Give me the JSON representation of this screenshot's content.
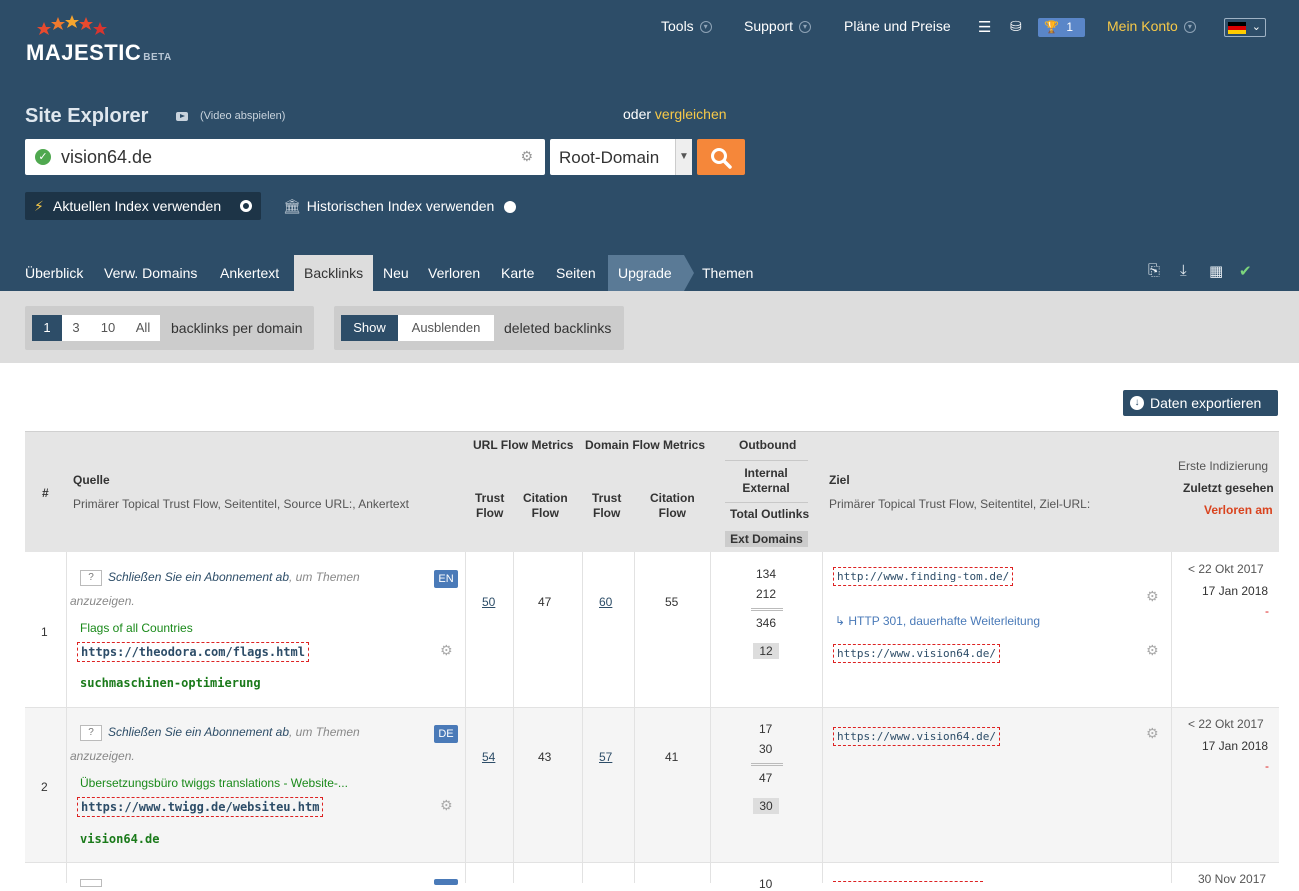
{
  "app": {
    "logo": "MAJESTIC",
    "beta": "BETA"
  },
  "topnav": {
    "tools": "Tools",
    "support": "Support",
    "plans": "Pläne und Preise",
    "trophy_count": "1",
    "account": "Mein Konto"
  },
  "search": {
    "title": "Site Explorer",
    "video": "(Video abspielen)",
    "oder": "oder",
    "compare": "vergleichen",
    "value": "vision64.de",
    "scope": "Root-Domain"
  },
  "index": {
    "current": "Aktuellen Index verwenden",
    "historic": "Historischen Index verwenden"
  },
  "tabs": [
    "Überblick",
    "Verw. Domains",
    "Ankertext",
    "Backlinks",
    "Neu",
    "Verloren",
    "Karte",
    "Seiten",
    "Upgrade",
    "Themen"
  ],
  "filters": {
    "per_domain_options": [
      "1",
      "3",
      "10",
      "All"
    ],
    "per_domain_label": "backlinks per domain",
    "deleted_options": [
      "Show",
      "Ausblenden"
    ],
    "deleted_label": "deleted backlinks"
  },
  "export_label": "Daten exportieren",
  "table": {
    "headers": {
      "num": "#",
      "source": "Quelle",
      "source_sub": "Primärer Topical Trust Flow, Seitentitel, Source URL:, Ankertext",
      "url_flow": "URL Flow Metrics",
      "domain_flow": "Domain Flow Metrics",
      "outbound": "Outbound",
      "trust_flow_1": "Trust",
      "trust_flow_2": "Flow",
      "citation_flow_1": "Citation",
      "citation_flow_2": "Flow",
      "internal": "Internal",
      "external": "External",
      "total_outlinks": "Total Outlinks",
      "ext_domains": "Ext Domains",
      "target": "Ziel",
      "target_sub": "Primärer Topical Trust Flow, Seitentitel, Ziel-URL:",
      "first_indexed": "Erste Indizierung",
      "last_seen": "Zuletzt gesehen",
      "lost_on": "Verloren am"
    },
    "subscribe_text": "Schließen Sie ein Abonnement ab",
    "subscribe_rest_1": ", um Themen",
    "subscribe_rest_2": "anzuzeigen.",
    "rows": [
      {
        "num": "1",
        "lang": "EN",
        "title": "Flags of all Countries",
        "source_url": "https://theodora.com/flags.html",
        "anchor": "suchmaschinen-optimierung",
        "url_tf": "50",
        "url_cf": "47",
        "dom_tf": "60",
        "dom_cf": "55",
        "internal": "134",
        "external": "212",
        "total": "346",
        "ext_domains": "12",
        "target_url": "http://www.finding-tom.de/",
        "redirect": "HTTP 301, dauerhafte Weiterleitung",
        "redirect_url": "https://www.vision64.de/",
        "first": "< 22 Okt 2017",
        "last": "17 Jan 2018",
        "lost": "-"
      },
      {
        "num": "2",
        "lang": "DE",
        "title": "Übersetzungsbüro twiggs translations - Website-...",
        "source_url": "https://www.twigg.de/websiteu.htm",
        "anchor": "vision64.de",
        "url_tf": "54",
        "url_cf": "43",
        "dom_tf": "57",
        "dom_cf": "41",
        "internal": "17",
        "external": "30",
        "total": "47",
        "ext_domains": "30",
        "target_url": "https://www.vision64.de/",
        "first": "< 22 Okt 2017",
        "last": "17 Jan 2018",
        "lost": "-"
      },
      {
        "num": "",
        "internal": "10",
        "first": "30 Nov 2017"
      }
    ]
  },
  "colors": {
    "header_bg": "#2d4d68",
    "accent_orange": "#f5873a",
    "accent_yellow": "#f7c948"
  }
}
